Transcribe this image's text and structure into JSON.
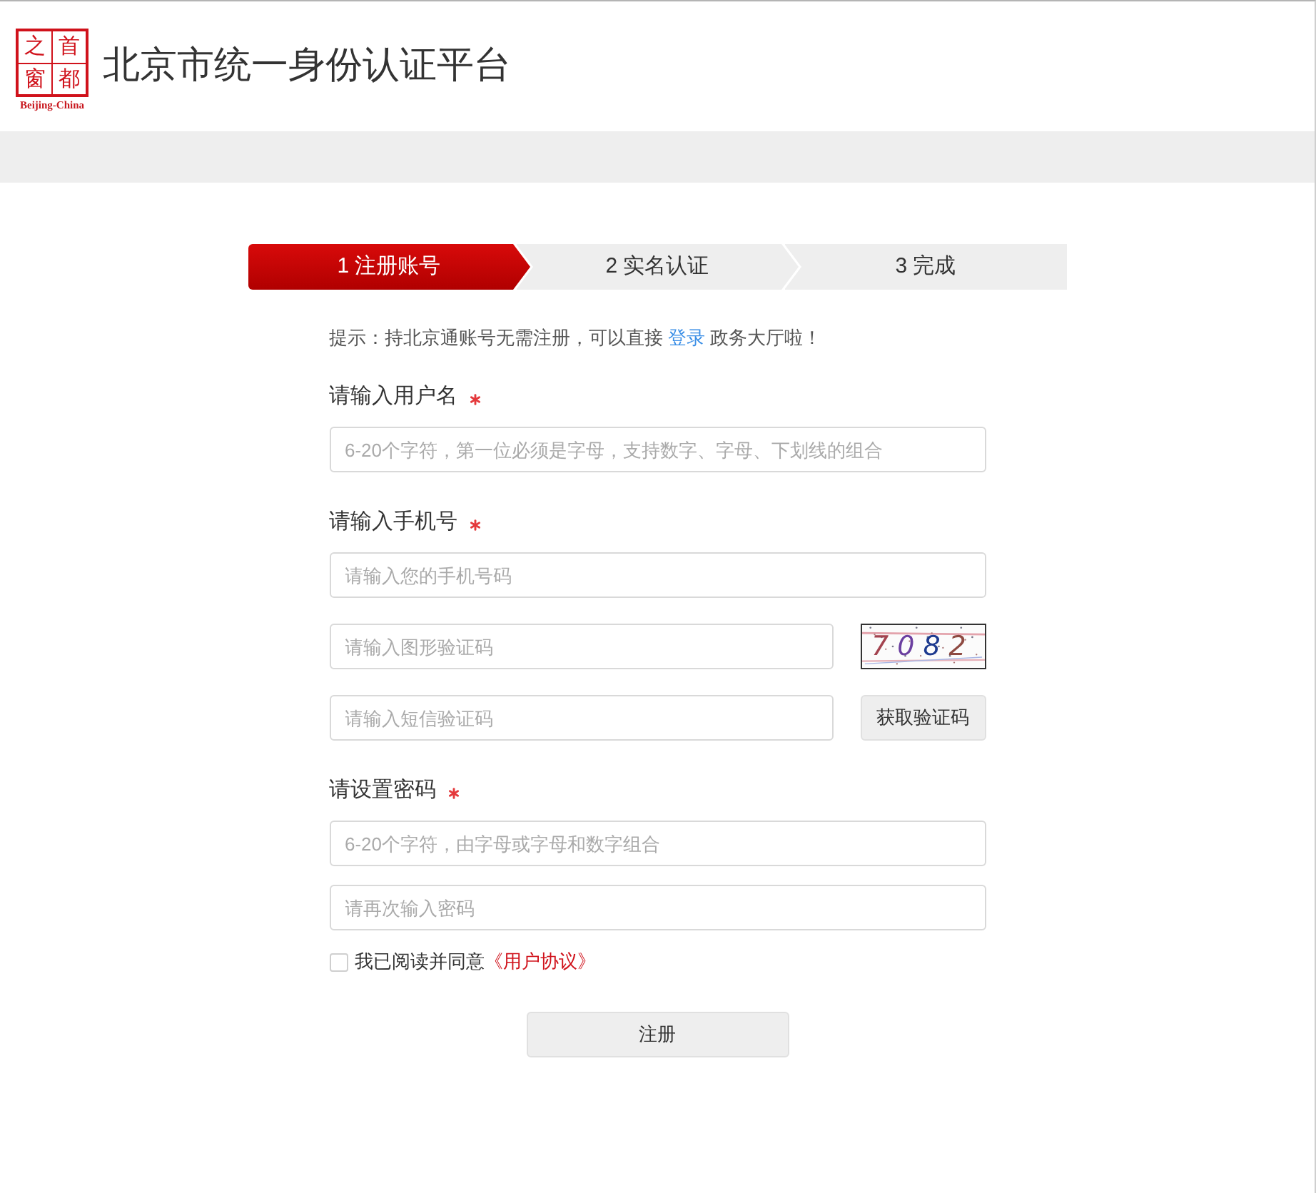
{
  "header": {
    "logo": {
      "characters": [
        "之",
        "首",
        "窗",
        "都"
      ],
      "caption": "Beijing-China"
    },
    "title": "北京市统一身份认证平台"
  },
  "steps": [
    {
      "label": "1 注册账号",
      "selected": true
    },
    {
      "label": "2 实名认证",
      "selected": false
    },
    {
      "label": "3 完成",
      "selected": false
    }
  ],
  "hint": {
    "before": "提示：持北京通账号无需注册，可以直接",
    "link": "登录",
    "after": "政务大厅啦！"
  },
  "form": {
    "sections": [
      {
        "label": "请输入用户名",
        "required": true,
        "fields": [
          {
            "kind": "input",
            "placeholder": "6-20个字符，第一位必须是字母，支持数字、字母、下划线的组合"
          }
        ]
      },
      {
        "label": "请输入手机号",
        "required": true,
        "fields": [
          {
            "kind": "input",
            "placeholder": "请输入您的手机号码"
          },
          {
            "kind": "captcha",
            "placeholder": "请输入图形验证码",
            "code": "7082"
          },
          {
            "kind": "sms",
            "placeholder": "请输入短信验证码",
            "button": "获取验证码"
          }
        ]
      },
      {
        "label": "请设置密码",
        "required": true,
        "fields": [
          {
            "kind": "input",
            "placeholder": "6-20个字符，由字母或字母和数字组合"
          },
          {
            "kind": "input",
            "placeholder": "请再次输入密码"
          }
        ]
      }
    ]
  },
  "agreement": {
    "checked": false,
    "text": "我已阅读并同意",
    "link": "《用户协议》"
  },
  "submit": "注册"
}
